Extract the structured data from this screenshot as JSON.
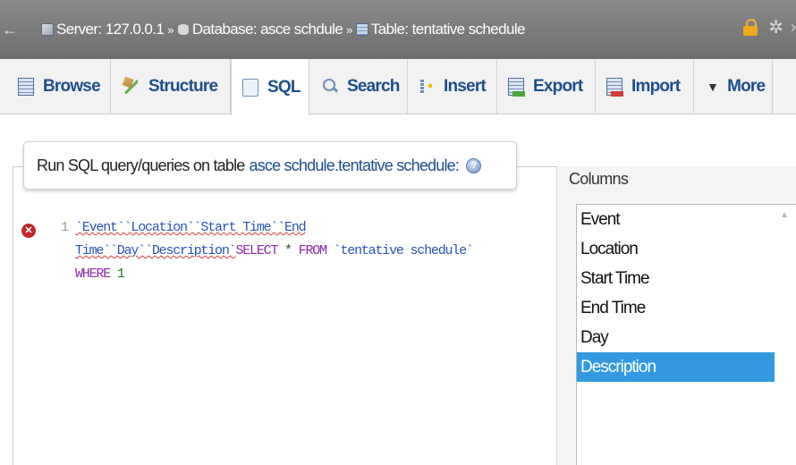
{
  "breadcrumb": {
    "server": "Server: 127.0.0.1",
    "database": "Database: asce schdule",
    "table": "Table: tentative schedule",
    "separator": "»"
  },
  "tabs": [
    {
      "label": "Browse",
      "icon": "browse-icon"
    },
    {
      "label": "Structure",
      "icon": "structure-icon"
    },
    {
      "label": "SQL",
      "icon": "sql-icon",
      "active": true
    },
    {
      "label": "Search",
      "icon": "search-icon"
    },
    {
      "label": "Insert",
      "icon": "insert-icon"
    },
    {
      "label": "Export",
      "icon": "export-icon"
    },
    {
      "label": "Import",
      "icon": "import-icon"
    },
    {
      "label": "More",
      "icon": "caret-down-icon"
    }
  ],
  "query_panel": {
    "title_prefix": "Run SQL query/queries on table",
    "table_name": "asce schdule.tentative schedule:"
  },
  "editor": {
    "line_number": "1",
    "line1": "`Event``Location``Start Time``End",
    "line2_ident": "Time``Day``Description`",
    "line2_select": "SELECT",
    "line2_star": " * ",
    "line2_from": "FROM",
    "line2_table": " `tentative schedule`",
    "line3_where": "WHERE",
    "line3_num": " 1"
  },
  "columns_panel": {
    "title": "Columns",
    "items": [
      "Event",
      "Location",
      "Start Time",
      "End Time",
      "Day",
      "Description"
    ],
    "selected_index": 5
  },
  "colors": {
    "topbar": "#7a7a7a",
    "tab_text": "#1d4e89",
    "selected": "#3399e0",
    "error": "#c0282a"
  }
}
